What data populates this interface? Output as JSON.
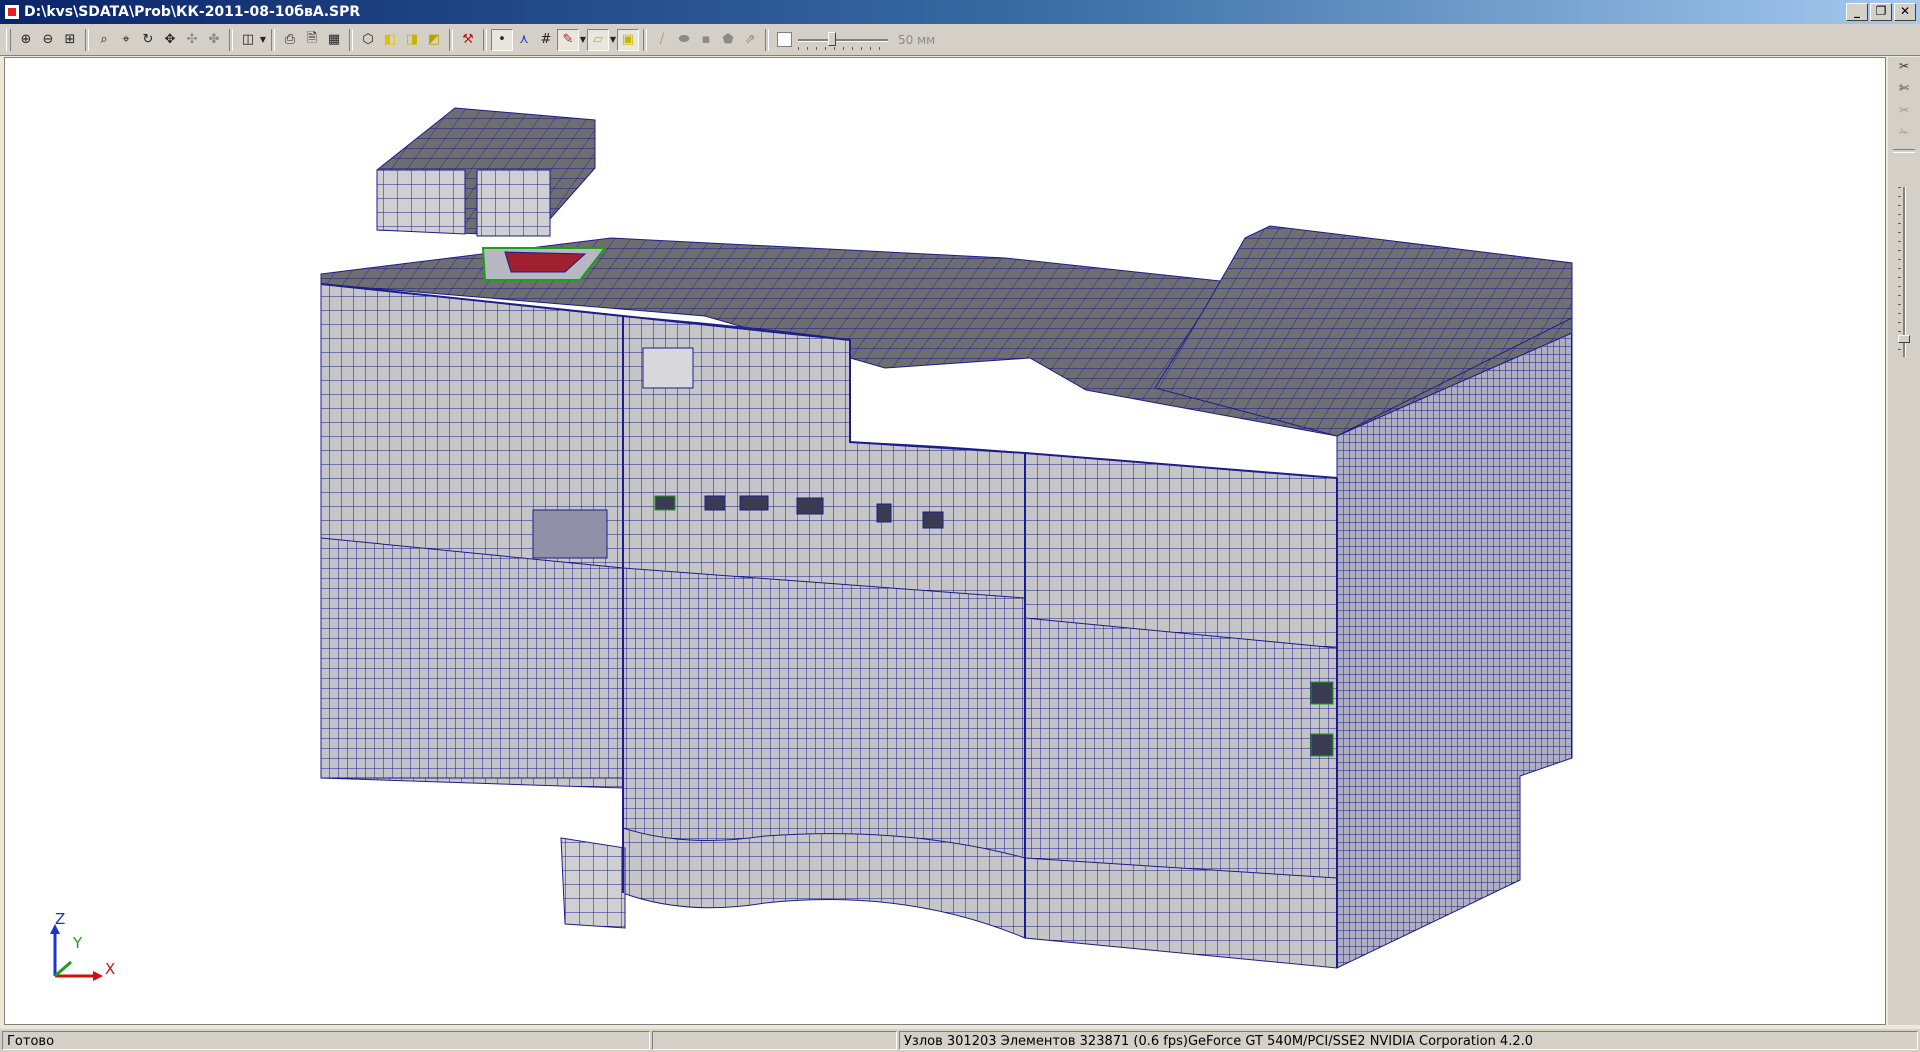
{
  "window": {
    "title": "D:\\kvs\\SDATA\\Prob\\КК-2011-08-10бвА.SPR",
    "buttons": {
      "minimize": "_",
      "restore": "❐",
      "close": "✕"
    }
  },
  "toolbar": {
    "groups": [
      [
        "zoom-in-icon",
        "zoom-out-icon",
        "zoom-fit-icon"
      ],
      [
        "zoom-window-icon",
        "zoom-dynamic-icon",
        "rotate-icon",
        "pan-icon",
        "orbit-icon",
        "spin-icon"
      ],
      [
        "view-cube-icon"
      ],
      [
        "print-icon",
        "print-preview-icon",
        "calculator-icon"
      ],
      [
        "wireframe-icon",
        "shade-yellow-icon",
        "shade-solid-icon",
        "shade-full-icon"
      ],
      [
        "measure-icon"
      ],
      [
        "node-icon",
        "element-icon",
        "mesh-icon",
        "pen-icon",
        "fill-icon",
        "paint-icon"
      ],
      [
        "section-a-icon",
        "section-b-icon",
        "section-c-icon",
        "section-d-icon",
        "section-e-icon"
      ]
    ],
    "slider_label": "50 мм"
  },
  "right_toolbar": {
    "icons": [
      "cut-icon",
      "cut-tool-icon",
      "cut-tool-disabled-icon",
      "cut-tool-off-icon"
    ]
  },
  "axes": {
    "z": "Z",
    "y": "Y",
    "x": "X"
  },
  "colors": {
    "mesh_fill": "#c8c8c8",
    "mesh_line": "#1c1c8c",
    "roof_fill": "#6b6b6b",
    "background": "#ffffff"
  },
  "status": {
    "ready": "Готово",
    "info": "Узлов 301203  Элементов 323871  (0.6 fps)GeForce GT 540M/PCI/SSE2 NVIDIA Corporation 4.2.0"
  }
}
